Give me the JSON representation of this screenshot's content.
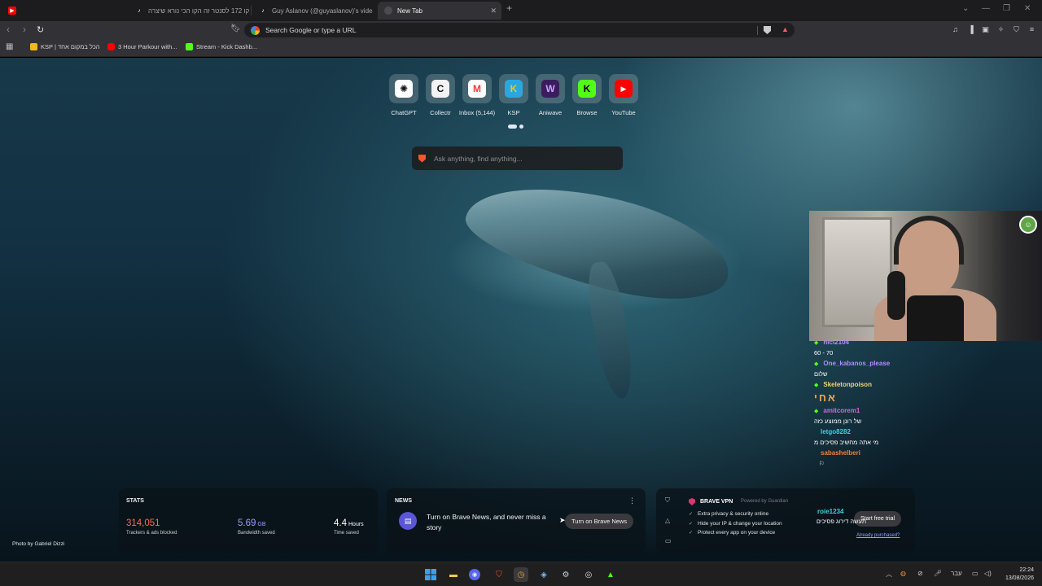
{
  "tabs": [
    {
      "title": "קו 172 לסנטר זה הקו הכי נורא שיצרה",
      "icon": "tiktok-icon"
    },
    {
      "title": "Guy Aslanov (@guyaslanov)'s videos",
      "icon": "tiktok-icon"
    },
    {
      "title": "New Tab",
      "icon": "brave-icon",
      "active": true
    }
  ],
  "new_tab_symbol": "+",
  "omnibox": {
    "placeholder": "Search Google or type a URL"
  },
  "bookmarks": [
    {
      "label": "KSP | הכל במקום אחד",
      "color": "#f5b81c"
    },
    {
      "label": "3 Hour Parkour with...",
      "color": "#ff0000"
    },
    {
      "label": "Stream - Kick Dashb...",
      "color": "#53fc18"
    }
  ],
  "top_sites": [
    {
      "label": "ChatGPT",
      "glyph": "✺",
      "bg": "#ffffff",
      "fg": "#111111"
    },
    {
      "label": "Collectr",
      "glyph": "C",
      "bg": "#f2f2f2",
      "fg": "#111111"
    },
    {
      "label": "Inbox (5,144)",
      "glyph": "M",
      "bg": "#ffffff",
      "fg": "#ea4335"
    },
    {
      "label": "KSP",
      "glyph": "K",
      "bg": "#29a8e0",
      "fg": "#f5c518"
    },
    {
      "label": "Aniwave",
      "glyph": "W",
      "bg": "#3b1d5e",
      "fg": "#c9a7ff"
    },
    {
      "label": "Browse",
      "glyph": "K",
      "bg": "#53fc18",
      "fg": "#000000"
    },
    {
      "label": "YouTube",
      "glyph": "▶",
      "bg": "#ff0000",
      "fg": "#ffffff"
    }
  ],
  "search": {
    "placeholder": "Ask anything, find anything..."
  },
  "photo_credit": "Photo by Gabriel Dizzi",
  "stats": {
    "title": "STATS",
    "items": [
      {
        "value": "314,051",
        "unit": "",
        "label": "Trackers & ads blocked",
        "color": "#ff6a4d"
      },
      {
        "value": "5.69",
        "unit": "GB",
        "label": "Bandwidth saved",
        "color": "#a59cff"
      },
      {
        "value": "4.4",
        "unit": "Hours",
        "label": "Time saved",
        "color": "#ffffff"
      }
    ]
  },
  "news": {
    "title": "NEWS",
    "message": "Turn on Brave News, and never miss a story",
    "button": "Turn on Brave News",
    "menu": "⋮"
  },
  "vpn": {
    "title": "BRAVE VPN",
    "powered": "Powered by Guardian",
    "features": [
      "Extra privacy & security online",
      "Hide your IP & change your location",
      "Protect every app on your device"
    ],
    "button": "Start free trial",
    "link": "Already purchased?"
  },
  "chat": [
    {
      "user": "nici2104",
      "color": "#b18cff",
      "badge": true,
      "text": "60 - 70"
    },
    {
      "user": "One_kabanos_please",
      "color": "#b18cff",
      "badge": true,
      "text": "שלום"
    },
    {
      "user": "Skeletonpoison",
      "color": "#f5d36a",
      "badge": true,
      "text": "אחי",
      "big": true
    },
    {
      "user": "amitcorem1",
      "color": "#c56fd8",
      "badge": true,
      "text": "של רונן ממוצע כזה"
    },
    {
      "user": "letgo8282",
      "color": "#39d3e0",
      "badge": false,
      "text": "מי אתה מחשיב פסיכים מ"
    },
    {
      "user": "sabashelberi",
      "color": "#f07f40",
      "badge": false,
      "text": "⚐"
    },
    {
      "user": "roie1234",
      "color": "#39d3e0",
      "badge": false,
      "text": "תעשה דירוג פסיכים"
    }
  ],
  "clock": {
    "time": "22:24",
    "date": "13/08/2026",
    "lang": "עבר"
  }
}
